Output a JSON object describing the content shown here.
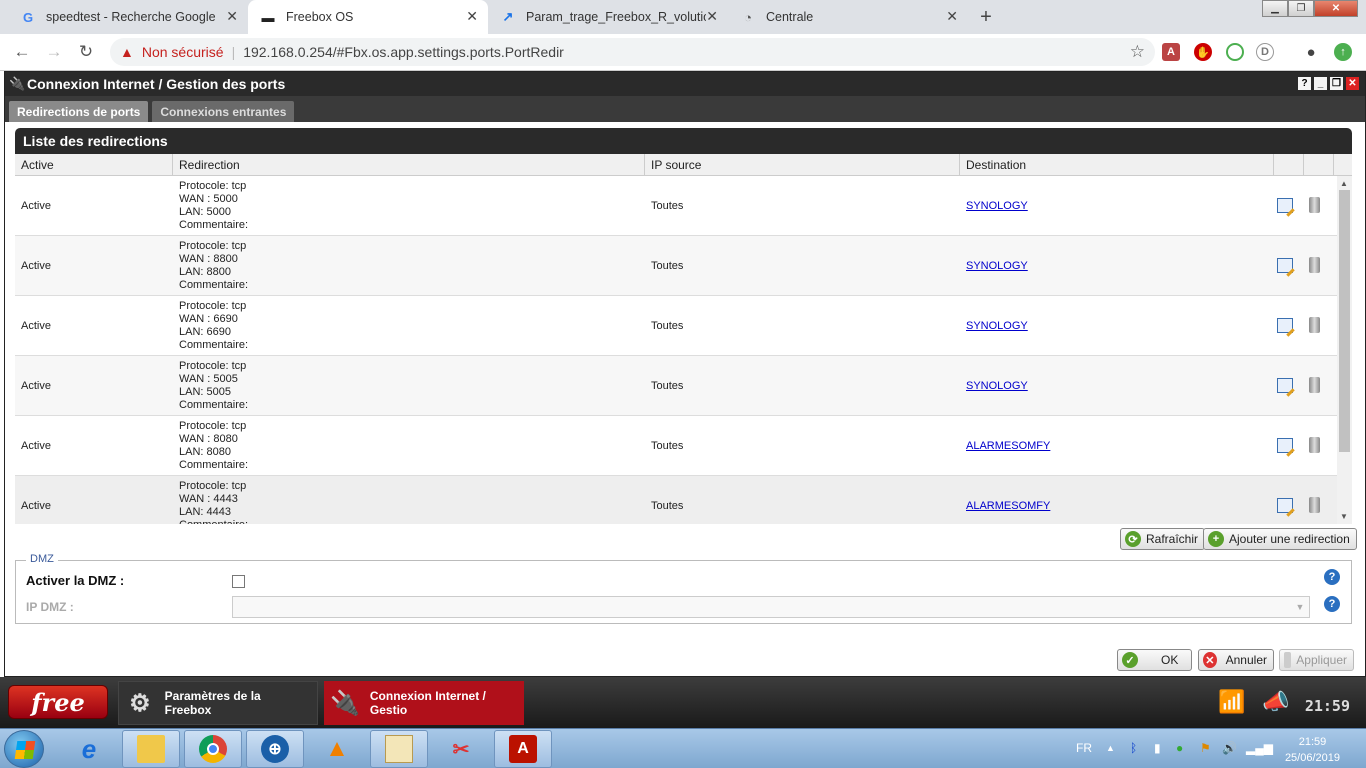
{
  "browser": {
    "tabs": [
      {
        "title": "speedtest - Recherche Google",
        "icon": "google-icon"
      },
      {
        "title": "Freebox OS",
        "icon": "freebox-icon",
        "active": true
      },
      {
        "title": "Param_trage_Freebox_R_volution",
        "icon": "arrow-icon"
      },
      {
        "title": "Centrale",
        "icon": "gauge-icon"
      }
    ],
    "security_label": "Non sécurisé",
    "url": "192.168.0.254/#Fbx.os.app.settings.ports.PortRedir"
  },
  "window": {
    "title": "Connexion Internet / Gestion des ports",
    "tabs": [
      "Redirections de ports",
      "Connexions entrantes"
    ],
    "active_tab": "Redirections de ports"
  },
  "panel": {
    "title": "Liste des redirections",
    "columns": [
      "Active",
      "Redirection",
      "IP source",
      "Destination"
    ],
    "rows": [
      {
        "active": "Active",
        "proto": "Protocole: tcp",
        "wan": "WAN : 5000",
        "lan": "LAN: 5000",
        "comment": "Commentaire:",
        "source": "Toutes",
        "dest": "SYNOLOGY"
      },
      {
        "active": "Active",
        "proto": "Protocole: tcp",
        "wan": "WAN : 8800",
        "lan": "LAN: 8800",
        "comment": "Commentaire:",
        "source": "Toutes",
        "dest": "SYNOLOGY"
      },
      {
        "active": "Active",
        "proto": "Protocole: tcp",
        "wan": "WAN : 6690",
        "lan": "LAN: 6690",
        "comment": "Commentaire:",
        "source": "Toutes",
        "dest": "SYNOLOGY"
      },
      {
        "active": "Active",
        "proto": "Protocole: tcp",
        "wan": "WAN : 5005",
        "lan": "LAN: 5005",
        "comment": "Commentaire:",
        "source": "Toutes",
        "dest": "SYNOLOGY"
      },
      {
        "active": "Active",
        "proto": "Protocole: tcp",
        "wan": "WAN : 8080",
        "lan": "LAN: 8080",
        "comment": "Commentaire:",
        "source": "Toutes",
        "dest": "ALARMESOMFY"
      },
      {
        "active": "Active",
        "proto": "Protocole: tcp",
        "wan": "WAN : 4443",
        "lan": "LAN: 4443",
        "comment": "Commentaire:",
        "source": "Toutes",
        "dest": "ALARMESOMFY"
      }
    ],
    "refresh_label": "Rafraîchir",
    "add_label": "Ajouter une redirection"
  },
  "dmz": {
    "legend": "DMZ",
    "enable_label": "Activer la DMZ :",
    "ip_label": "IP DMZ :",
    "enabled": false
  },
  "footer": {
    "ok": "OK",
    "cancel": "Annuler",
    "apply": "Appliquer"
  },
  "freebox_bar": {
    "logo": "free",
    "items": [
      "Paramètres de la Freebox",
      "Connexion Internet / Gestio"
    ],
    "clock": "21:59"
  },
  "windows_taskbar": {
    "lang": "FR",
    "time": "21:59",
    "date": "25/06/2019"
  },
  "colors": {
    "accent_red": "#b0101a",
    "link": "#0000cc",
    "header_dark": "#2a2a2a"
  }
}
